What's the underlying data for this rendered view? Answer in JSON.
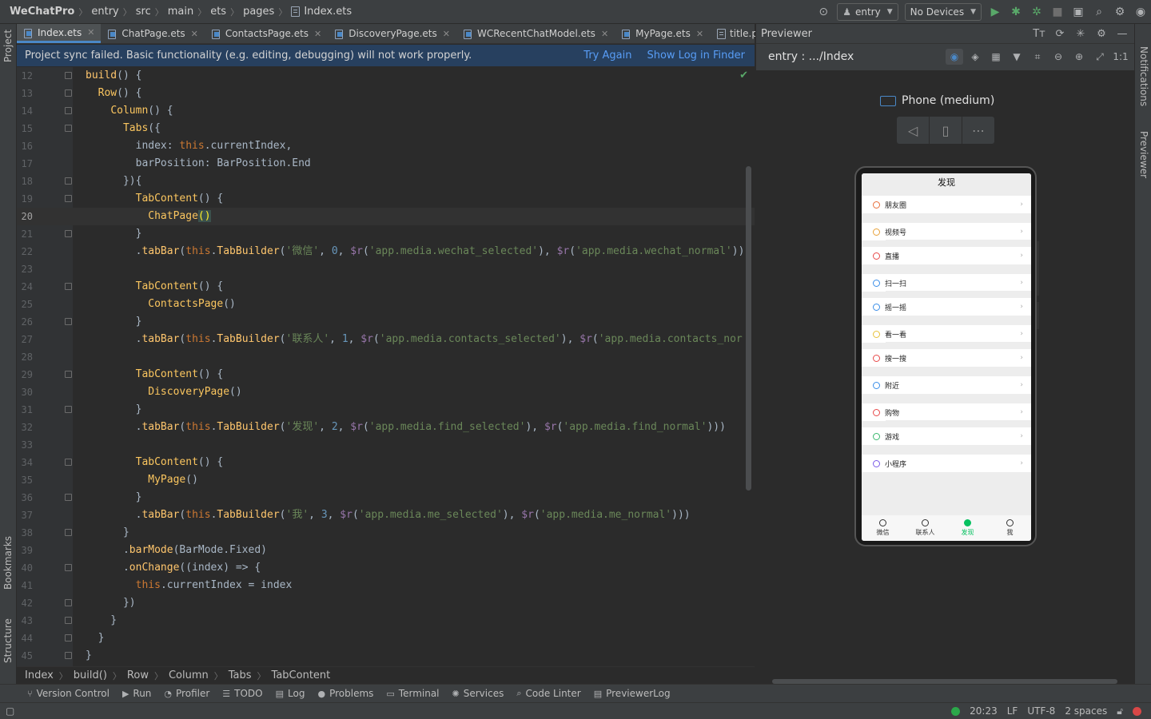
{
  "breadcrumb": [
    "WeChatPro",
    "entry",
    "src",
    "main",
    "ets",
    "pages",
    "Index.ets"
  ],
  "toolbar": {
    "module": "entry",
    "devices": "No Devices"
  },
  "left_strip": {
    "project": "Project",
    "bookmarks": "Bookmarks",
    "structure": "Structure"
  },
  "right_strip": {
    "notifications": "Notifications",
    "previewer": "Previewer"
  },
  "tabs": [
    {
      "label": "Index.ets",
      "active": true
    },
    {
      "label": "ChatPage.ets",
      "active": false
    },
    {
      "label": "ContactsPage.ets",
      "active": false
    },
    {
      "label": "DiscoveryPage.ets",
      "active": false
    },
    {
      "label": "WCRecentChatModel.ets",
      "active": false
    },
    {
      "label": "MyPage.ets",
      "active": false
    },
    {
      "label": "title.png",
      "active": false
    }
  ],
  "notice": {
    "message": "Project sync failed. Basic functionality (e.g. editing, debugging) will not work properly.",
    "try_again": "Try Again",
    "show_log": "Show Log in Finder"
  },
  "editor": {
    "first_line": 12,
    "current_line": 20
  },
  "code_breadcrumb": [
    "Index",
    "build()",
    "Row",
    "Column",
    "Tabs",
    "TabContent"
  ],
  "previewer": {
    "title": "Previewer",
    "path": "entry : .../Index",
    "device": "Phone (medium)",
    "screen_title": "发现",
    "items": [
      {
        "label": "朋友圈",
        "color": "#e86e3a"
      },
      {
        "label": "视频号",
        "color": "#e8a23a"
      },
      {
        "label": "直播",
        "color": "#e84a4a"
      },
      {
        "label": "扫一扫",
        "color": "#3a8ee8"
      },
      {
        "label": "摇一摇",
        "color": "#3a8ee8"
      },
      {
        "label": "看一看",
        "color": "#e8c23a"
      },
      {
        "label": "搜一搜",
        "color": "#e84a4a"
      },
      {
        "label": "附近",
        "color": "#3a8ee8"
      },
      {
        "label": "购物",
        "color": "#e84a4a"
      },
      {
        "label": "游戏",
        "color": "#3ab86e"
      },
      {
        "label": "小程序",
        "color": "#7a5ae8"
      }
    ],
    "bottom_tabs": [
      {
        "label": "微信",
        "selected": false
      },
      {
        "label": "联系人",
        "selected": false
      },
      {
        "label": "发现",
        "selected": true
      },
      {
        "label": "我",
        "selected": false
      }
    ]
  },
  "tool_windows": [
    "Version Control",
    "Run",
    "Profiler",
    "TODO",
    "Log",
    "Problems",
    "Terminal",
    "Services",
    "Code Linter",
    "PreviewerLog"
  ],
  "status": {
    "position": "20:23",
    "line_sep": "LF",
    "encoding": "UTF-8",
    "indent": "2 spaces"
  }
}
